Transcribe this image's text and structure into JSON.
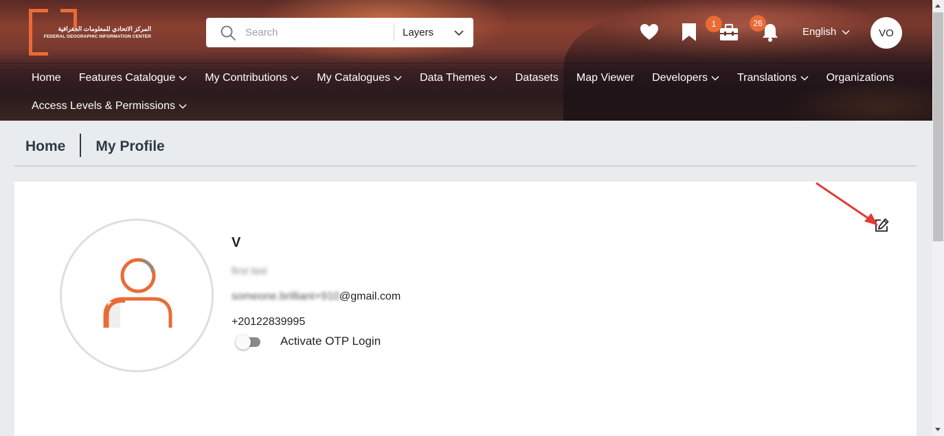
{
  "header": {
    "logo": {
      "arabic_text": "المركز الاتحادي للمعلومات الجغرافية",
      "english_text": "FEDERAL GEOGRAPHIC INFORMATION CENTER"
    },
    "search": {
      "placeholder": "Search",
      "scope_label": "Layers"
    },
    "icons": {
      "favorites": "heart-icon",
      "bookmarks": "bookmark-icon",
      "toolbox": "briefcase-icon",
      "notifications": "bell-icon"
    },
    "toolbox_badge": "1",
    "notifications_badge": "26",
    "language": "English",
    "user_initials": "VO",
    "accent_color": "#ea6b36"
  },
  "nav": {
    "row1": [
      {
        "label": "Home",
        "dropdown": false
      },
      {
        "label": "Features Catalogue",
        "dropdown": true
      },
      {
        "label": "My Contributions",
        "dropdown": true
      },
      {
        "label": "My Catalogues",
        "dropdown": true
      },
      {
        "label": "Data Themes",
        "dropdown": true
      },
      {
        "label": "Datasets",
        "dropdown": false
      },
      {
        "label": "Map Viewer",
        "dropdown": false
      },
      {
        "label": "Developers",
        "dropdown": true
      },
      {
        "label": "Translations",
        "dropdown": true
      },
      {
        "label": "Organizations",
        "dropdown": false
      }
    ],
    "row2": [
      {
        "label": "Access Levels & Permissions",
        "dropdown": true
      }
    ]
  },
  "breadcrumb": {
    "home": "Home",
    "current": "My Profile"
  },
  "profile": {
    "name": "V",
    "full_name": "first last",
    "email_hidden": "someone.brilliant+910",
    "email_domain": "@gmail.com",
    "phone": "+20122839995",
    "otp_label": "Activate OTP Login",
    "otp_enabled": false,
    "edit_icon": "edit-icon"
  }
}
